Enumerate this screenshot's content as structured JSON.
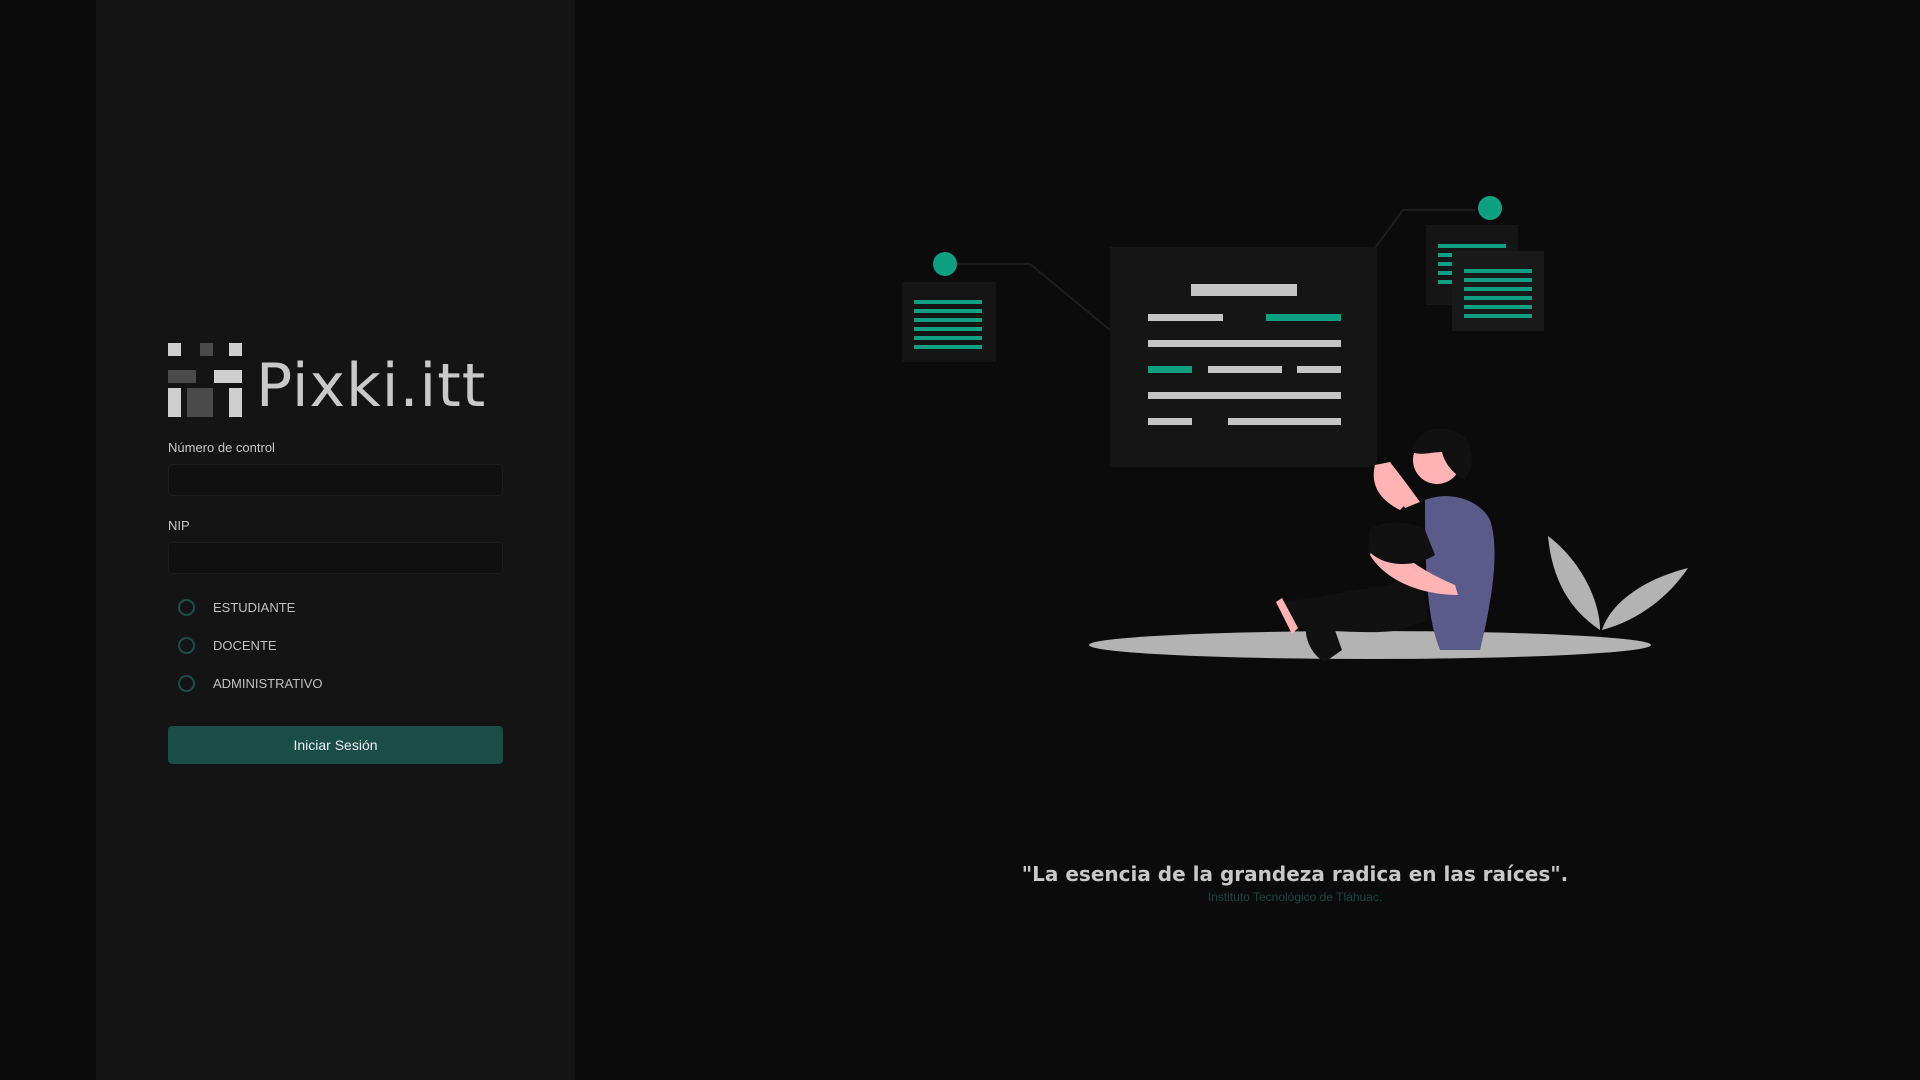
{
  "brand": {
    "name": "Pixki",
    "suffix": ".itt",
    "accent_color": "#1b4d47",
    "illustration_accent": "#0f9f82"
  },
  "login": {
    "control_label": "Número de control",
    "control_value": "",
    "nip_label": "NIP",
    "nip_value": "",
    "roles": [
      {
        "label": "ESTUDIANTE",
        "selected": false
      },
      {
        "label": "DOCENTE",
        "selected": false
      },
      {
        "label": "ADMINISTRATIVO",
        "selected": false
      }
    ],
    "submit_label": "Iniciar Sesión"
  },
  "illustration": {
    "icon": "person-thinking-with-documents-illustration"
  },
  "quote": {
    "text": "\"La esencia de la grandeza radica en las raíces\".",
    "source": "Instituto Tecnológico de Tláhuac."
  }
}
